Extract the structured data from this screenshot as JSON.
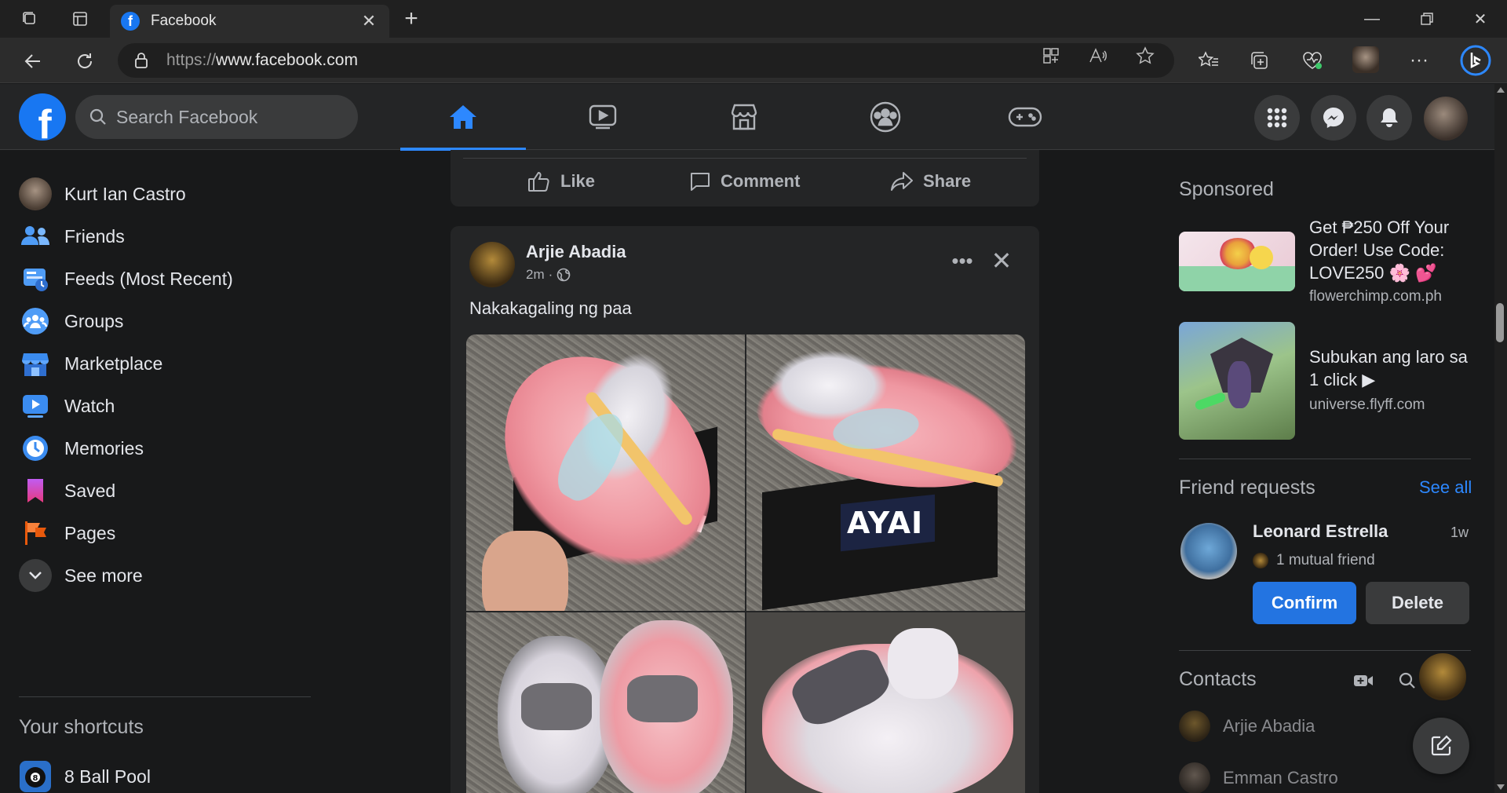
{
  "browser": {
    "tab_title": "Facebook",
    "url_protocol": "https://",
    "url_host": "www.facebook.com"
  },
  "header": {
    "search_placeholder": "Search Facebook",
    "nav_tabs": [
      "home-icon",
      "watch-icon",
      "marketplace-icon",
      "groups-icon",
      "gaming-icon"
    ],
    "active_tab": "home"
  },
  "sidebar": {
    "items": [
      {
        "label": "Kurt Ian Castro",
        "icon": "profile-avatar"
      },
      {
        "label": "Friends",
        "icon": "friends-icon"
      },
      {
        "label": "Feeds (Most Recent)",
        "icon": "feeds-icon"
      },
      {
        "label": "Groups",
        "icon": "groups-icon"
      },
      {
        "label": "Marketplace",
        "icon": "marketplace-icon"
      },
      {
        "label": "Watch",
        "icon": "watch-icon"
      },
      {
        "label": "Memories",
        "icon": "memories-icon"
      },
      {
        "label": "Saved",
        "icon": "saved-icon"
      },
      {
        "label": "Pages",
        "icon": "pages-icon"
      },
      {
        "label": "See more",
        "icon": "chevron-down-icon"
      }
    ],
    "shortcuts_title": "Your shortcuts",
    "shortcuts": [
      {
        "label": "8 Ball Pool"
      }
    ]
  },
  "feed": {
    "actions": {
      "like": "Like",
      "comment": "Comment",
      "share": "Share"
    },
    "post": {
      "author": "Arjie Abadia",
      "time": "2m",
      "privacy": "·",
      "text": "Nakakagaling ng paa",
      "box_brand": "AYAI"
    }
  },
  "right": {
    "sponsored_title": "Sponsored",
    "ads": [
      {
        "title": "Get ₱250 Off Your Order! Use Code: LOVE250 🌸 💕",
        "url": "flowerchimp.com.ph"
      },
      {
        "title": "Subukan ang laro sa 1 click ▶",
        "url": "universe.flyff.com"
      }
    ],
    "friend_requests_title": "Friend requests",
    "see_all": "See all",
    "request": {
      "name": "Leonard Estrella",
      "time": "1w",
      "mutual": "1 mutual friend",
      "confirm": "Confirm",
      "delete": "Delete"
    },
    "contacts_title": "Contacts",
    "contacts": [
      "Arjie Abadia",
      "Emman Castro"
    ]
  },
  "colors": {
    "accent": "#2d88ff",
    "brand": "#1877f2",
    "bg": "#18191a",
    "surface": "#242526"
  }
}
